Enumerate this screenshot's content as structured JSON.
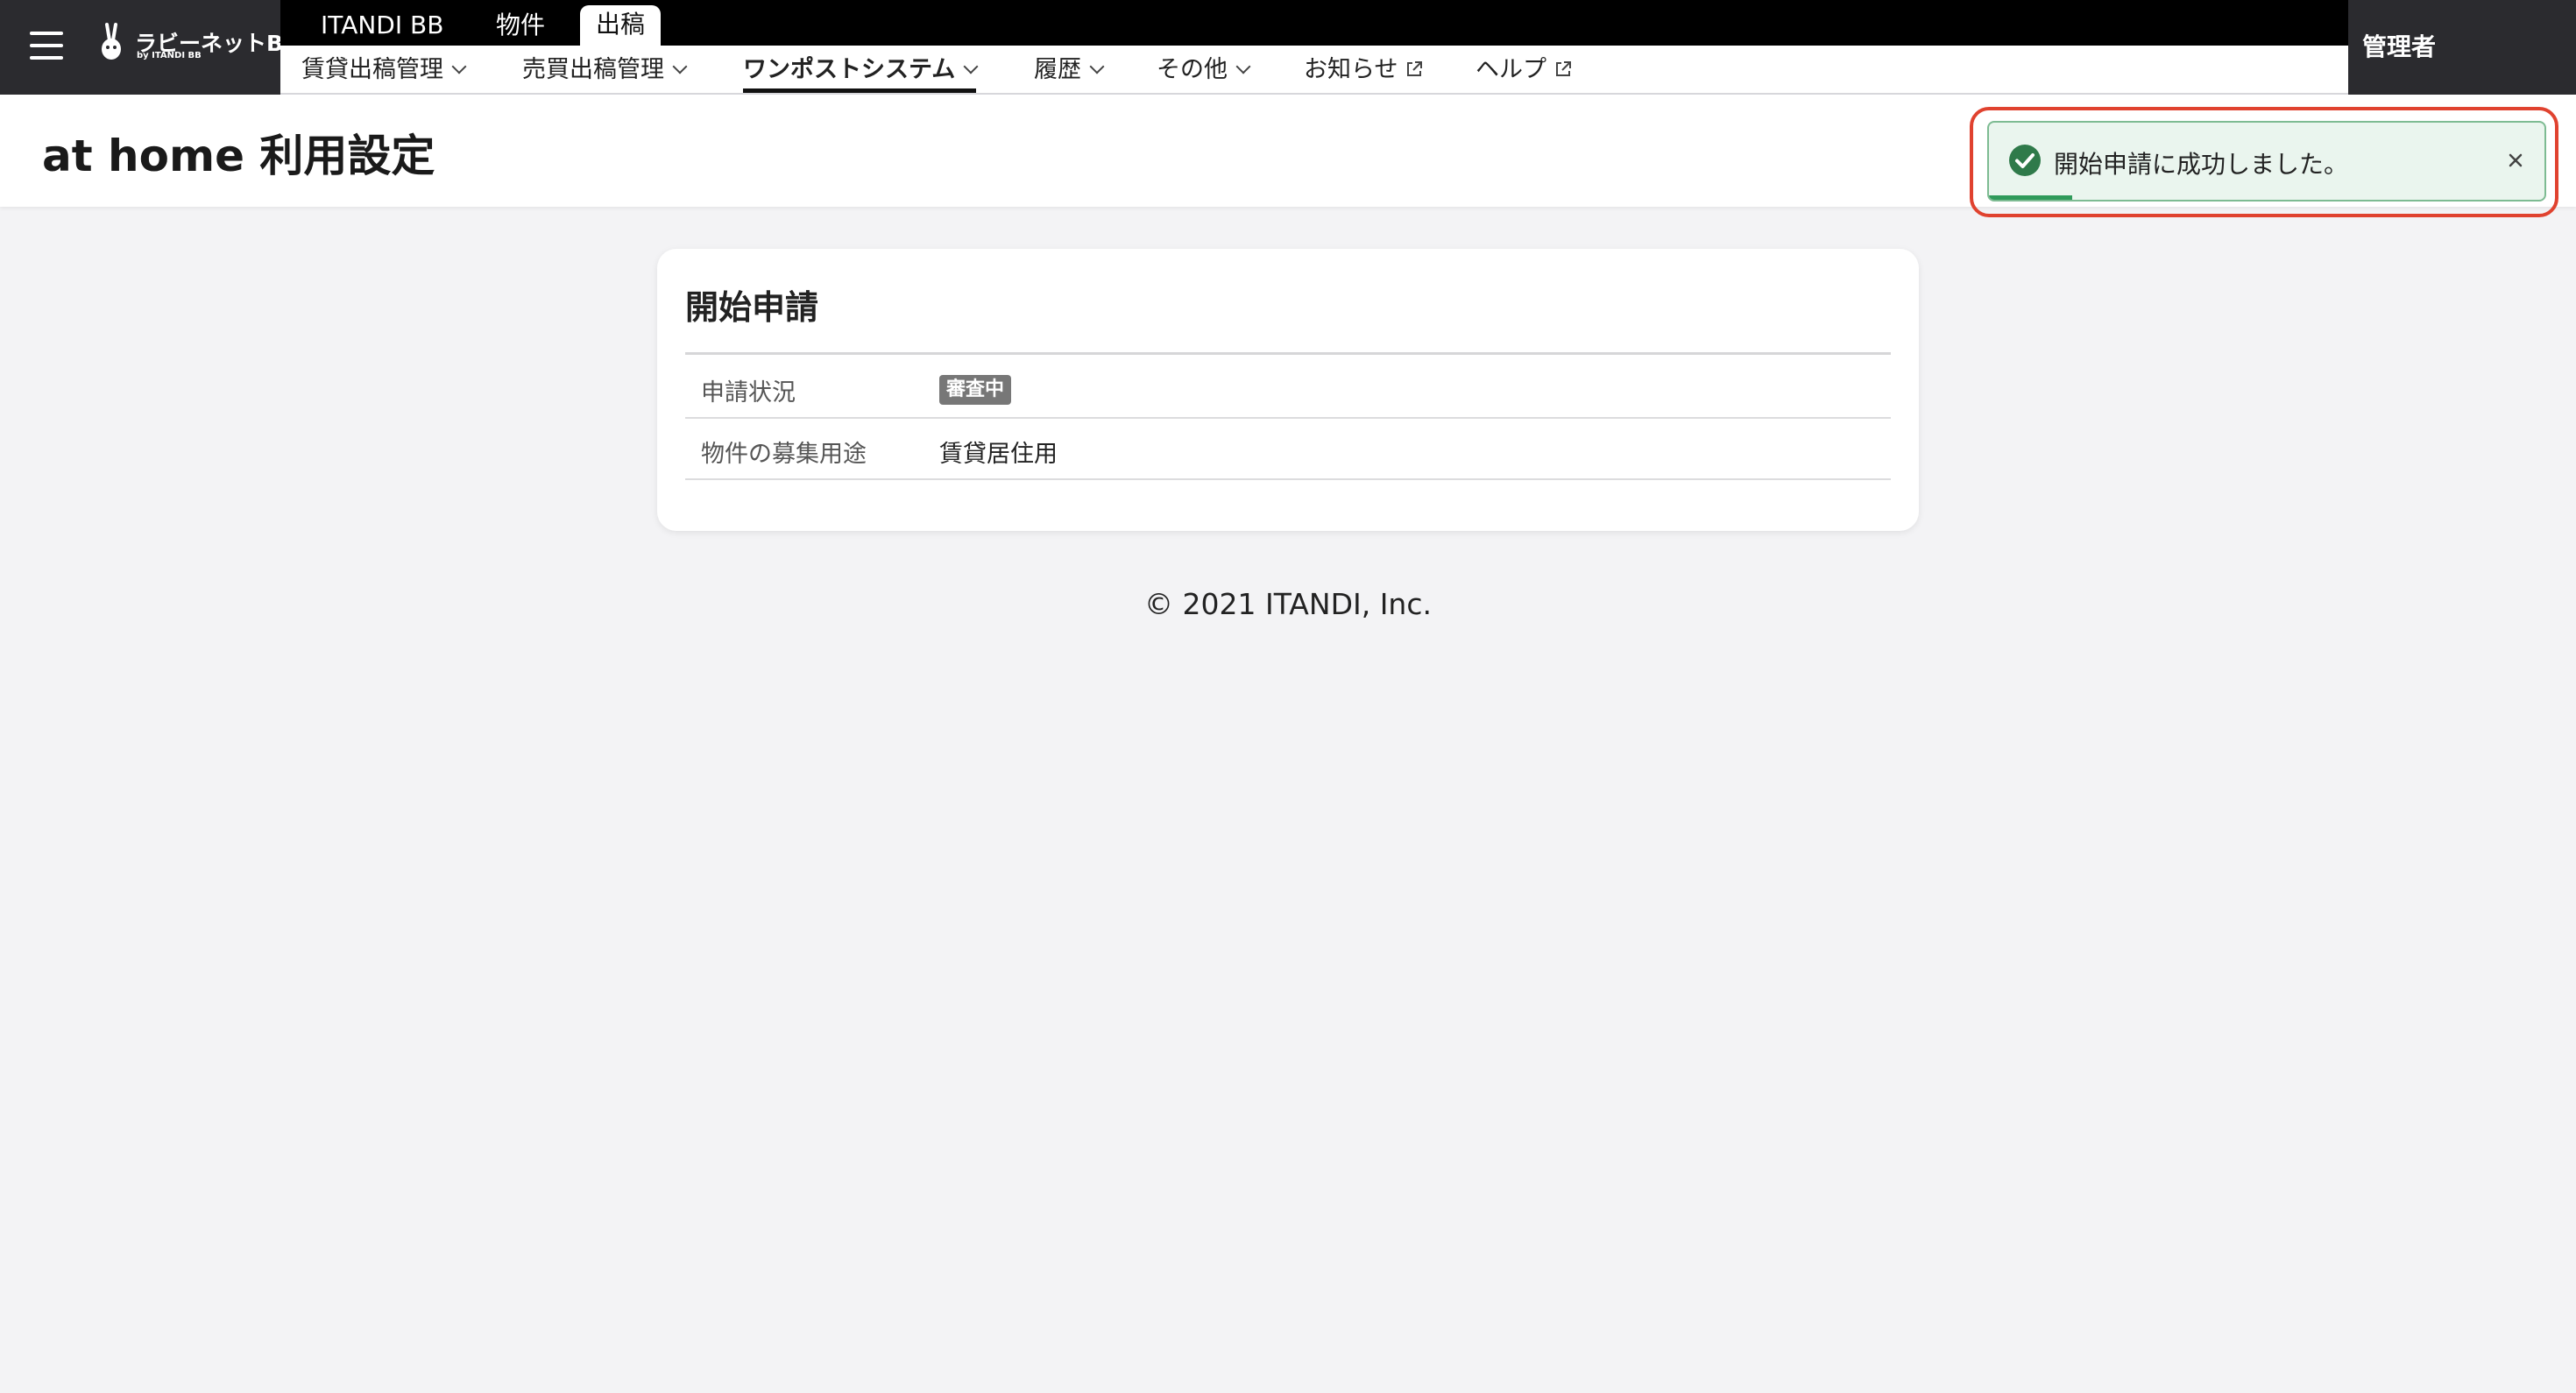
{
  "header": {
    "logo_text": "ラビーネットBB",
    "logo_sub": "by ITANDI BB",
    "top_tabs": [
      {
        "label": "ITANDI BB"
      },
      {
        "label": "物件"
      },
      {
        "label": "出稿"
      }
    ],
    "subnav": [
      {
        "label": "賃貸出稿管理"
      },
      {
        "label": "売買出稿管理"
      },
      {
        "label": "ワンポストシステム"
      },
      {
        "label": "履歴"
      },
      {
        "label": "その他"
      },
      {
        "label": "お知らせ"
      },
      {
        "label": "ヘルプ"
      }
    ],
    "user_label": "管理者"
  },
  "page": {
    "title": "at home 利用設定"
  },
  "card": {
    "title": "開始申請",
    "rows": [
      {
        "label": "申請状況",
        "value": "審査中"
      },
      {
        "label": "物件の募集用途",
        "value": "賃貸居住用"
      }
    ]
  },
  "footer": {
    "copyright": "© 2021 ITANDI, Inc."
  },
  "toast": {
    "message": "開始申請に成功しました。",
    "progress": 0.15
  },
  "colors": {
    "success": "#2f9a5a",
    "highlight_outline": "#e0422f",
    "badge": "#777777"
  }
}
